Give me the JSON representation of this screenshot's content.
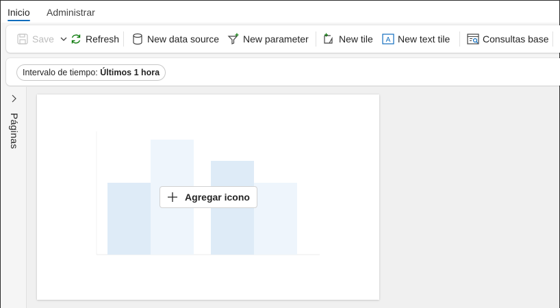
{
  "tabs": [
    {
      "label": "Inicio",
      "active": true
    },
    {
      "label": "Administrar",
      "active": false
    }
  ],
  "toolbar": {
    "save_label": "Save",
    "refresh_label": "Refresh",
    "new_data_source_label": "New data source",
    "new_parameter_label": "New parameter",
    "new_tile_label": "New tile",
    "new_text_tile_label": "New text tile",
    "base_queries_label": "Consultas base"
  },
  "filter": {
    "label": "Intervalo de tiempo:",
    "value": "Últimos 1 hora"
  },
  "pages": {
    "label": "Páginas"
  },
  "tile": {
    "add_button_label": "Agregar icono"
  },
  "colors": {
    "accent": "#0f6cbd",
    "bar_dark": "#deebf7",
    "bar_light": "#eef5fc",
    "canvas_bg": "#f0f0f0"
  },
  "icons": [
    "save-icon",
    "chevron-down-icon",
    "refresh-icon",
    "database-icon",
    "filter-add-icon",
    "tile-add-icon",
    "text-tile-icon",
    "base-query-icon",
    "chevron-right-icon",
    "plus-icon"
  ]
}
